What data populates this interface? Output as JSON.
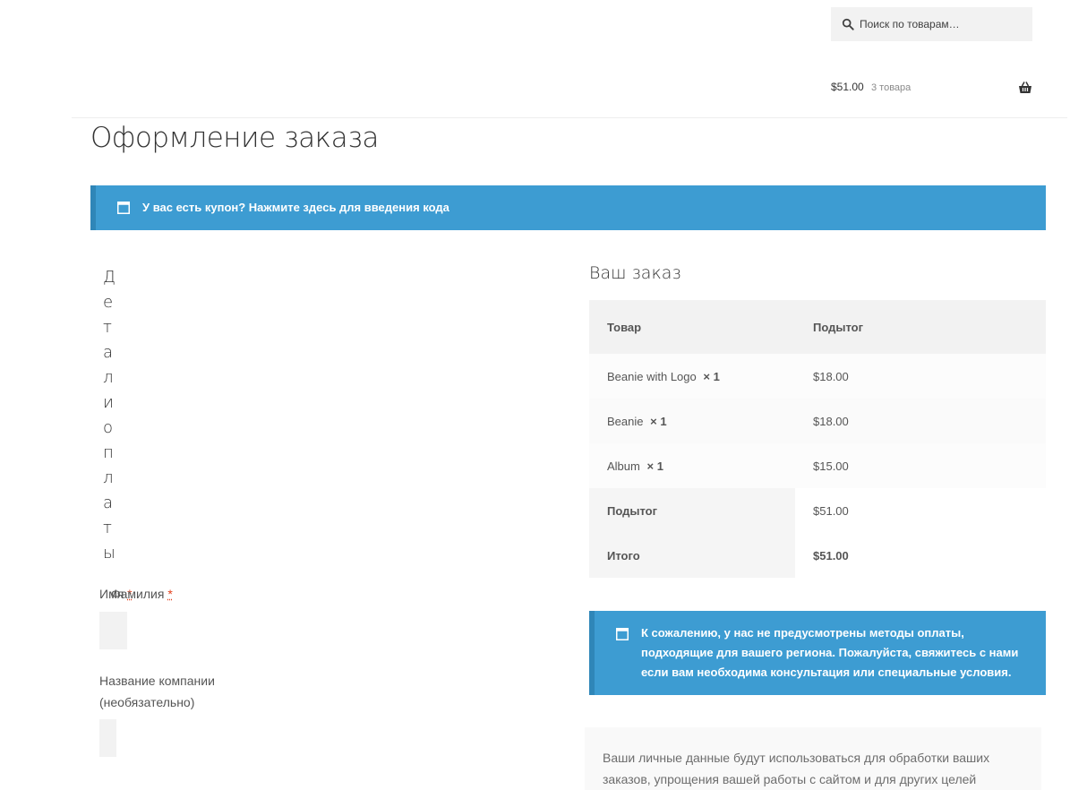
{
  "header": {
    "search_placeholder": "Поиск по товарам…",
    "cart_total": "$51.00",
    "cart_count": "3 товара"
  },
  "page": {
    "title": "Оформление заказа"
  },
  "coupon_notice": {
    "text": "У вас есть купон? Нажмите здесь для введения кода"
  },
  "billing": {
    "heading": "Детали оплаты",
    "first_name_label": "Имя",
    "last_name_label": "Фамилия",
    "required_mark": "*",
    "company_label": "Название компании (необязательно)"
  },
  "order": {
    "heading": "Ваш заказ",
    "columns": {
      "product": "Товар",
      "subtotal": "Подытог"
    },
    "items": [
      {
        "name": "Beanie with Logo",
        "qty": "× 1",
        "price": "$18.00"
      },
      {
        "name": "Beanie",
        "qty": "× 1",
        "price": "$18.00"
      },
      {
        "name": "Album",
        "qty": "× 1",
        "price": "$15.00"
      }
    ],
    "subtotal_label": "Подытог",
    "subtotal_value": "$51.00",
    "total_label": "Итого",
    "total_value": "$51.00"
  },
  "payment_notice": {
    "text": "К сожалению, у нас не предусмотрены методы оплаты, подходящие для вашего региона. Пожалуйста, свяжитесь с нами если вам необходима консультация или специальные условия."
  },
  "privacy": {
    "text": "Ваши личные данные будут использоваться для обработки ваших заказов, упрощения вашей работы с сайтом и для других целей"
  },
  "colors": {
    "notice_bg": "#3d9cd2",
    "accent_required": "#e2401c"
  }
}
